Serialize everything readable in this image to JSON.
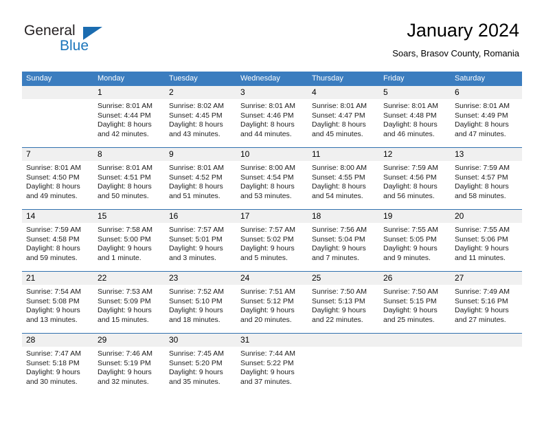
{
  "brand": {
    "name_part1": "General",
    "name_part2": "Blue",
    "accent_color": "#1b75bb"
  },
  "header": {
    "title": "January 2024",
    "subtitle": "Soars, Brasov County, Romania",
    "header_bg_color": "#3b7dbf",
    "daynum_bg_color": "#f0f0f0",
    "separator_color": "#2f6fae"
  },
  "weekdays": [
    "Sunday",
    "Monday",
    "Tuesday",
    "Wednesday",
    "Thursday",
    "Friday",
    "Saturday"
  ],
  "weeks": [
    {
      "days": [
        {
          "num": "",
          "lines": []
        },
        {
          "num": "1",
          "lines": [
            "Sunrise: 8:01 AM",
            "Sunset: 4:44 PM",
            "Daylight: 8 hours",
            "and 42 minutes."
          ]
        },
        {
          "num": "2",
          "lines": [
            "Sunrise: 8:02 AM",
            "Sunset: 4:45 PM",
            "Daylight: 8 hours",
            "and 43 minutes."
          ]
        },
        {
          "num": "3",
          "lines": [
            "Sunrise: 8:01 AM",
            "Sunset: 4:46 PM",
            "Daylight: 8 hours",
            "and 44 minutes."
          ]
        },
        {
          "num": "4",
          "lines": [
            "Sunrise: 8:01 AM",
            "Sunset: 4:47 PM",
            "Daylight: 8 hours",
            "and 45 minutes."
          ]
        },
        {
          "num": "5",
          "lines": [
            "Sunrise: 8:01 AM",
            "Sunset: 4:48 PM",
            "Daylight: 8 hours",
            "and 46 minutes."
          ]
        },
        {
          "num": "6",
          "lines": [
            "Sunrise: 8:01 AM",
            "Sunset: 4:49 PM",
            "Daylight: 8 hours",
            "and 47 minutes."
          ]
        }
      ]
    },
    {
      "days": [
        {
          "num": "7",
          "lines": [
            "Sunrise: 8:01 AM",
            "Sunset: 4:50 PM",
            "Daylight: 8 hours",
            "and 49 minutes."
          ]
        },
        {
          "num": "8",
          "lines": [
            "Sunrise: 8:01 AM",
            "Sunset: 4:51 PM",
            "Daylight: 8 hours",
            "and 50 minutes."
          ]
        },
        {
          "num": "9",
          "lines": [
            "Sunrise: 8:01 AM",
            "Sunset: 4:52 PM",
            "Daylight: 8 hours",
            "and 51 minutes."
          ]
        },
        {
          "num": "10",
          "lines": [
            "Sunrise: 8:00 AM",
            "Sunset: 4:54 PM",
            "Daylight: 8 hours",
            "and 53 minutes."
          ]
        },
        {
          "num": "11",
          "lines": [
            "Sunrise: 8:00 AM",
            "Sunset: 4:55 PM",
            "Daylight: 8 hours",
            "and 54 minutes."
          ]
        },
        {
          "num": "12",
          "lines": [
            "Sunrise: 7:59 AM",
            "Sunset: 4:56 PM",
            "Daylight: 8 hours",
            "and 56 minutes."
          ]
        },
        {
          "num": "13",
          "lines": [
            "Sunrise: 7:59 AM",
            "Sunset: 4:57 PM",
            "Daylight: 8 hours",
            "and 58 minutes."
          ]
        }
      ]
    },
    {
      "days": [
        {
          "num": "14",
          "lines": [
            "Sunrise: 7:59 AM",
            "Sunset: 4:58 PM",
            "Daylight: 8 hours",
            "and 59 minutes."
          ]
        },
        {
          "num": "15",
          "lines": [
            "Sunrise: 7:58 AM",
            "Sunset: 5:00 PM",
            "Daylight: 9 hours",
            "and 1 minute."
          ]
        },
        {
          "num": "16",
          "lines": [
            "Sunrise: 7:57 AM",
            "Sunset: 5:01 PM",
            "Daylight: 9 hours",
            "and 3 minutes."
          ]
        },
        {
          "num": "17",
          "lines": [
            "Sunrise: 7:57 AM",
            "Sunset: 5:02 PM",
            "Daylight: 9 hours",
            "and 5 minutes."
          ]
        },
        {
          "num": "18",
          "lines": [
            "Sunrise: 7:56 AM",
            "Sunset: 5:04 PM",
            "Daylight: 9 hours",
            "and 7 minutes."
          ]
        },
        {
          "num": "19",
          "lines": [
            "Sunrise: 7:55 AM",
            "Sunset: 5:05 PM",
            "Daylight: 9 hours",
            "and 9 minutes."
          ]
        },
        {
          "num": "20",
          "lines": [
            "Sunrise: 7:55 AM",
            "Sunset: 5:06 PM",
            "Daylight: 9 hours",
            "and 11 minutes."
          ]
        }
      ]
    },
    {
      "days": [
        {
          "num": "21",
          "lines": [
            "Sunrise: 7:54 AM",
            "Sunset: 5:08 PM",
            "Daylight: 9 hours",
            "and 13 minutes."
          ]
        },
        {
          "num": "22",
          "lines": [
            "Sunrise: 7:53 AM",
            "Sunset: 5:09 PM",
            "Daylight: 9 hours",
            "and 15 minutes."
          ]
        },
        {
          "num": "23",
          "lines": [
            "Sunrise: 7:52 AM",
            "Sunset: 5:10 PM",
            "Daylight: 9 hours",
            "and 18 minutes."
          ]
        },
        {
          "num": "24",
          "lines": [
            "Sunrise: 7:51 AM",
            "Sunset: 5:12 PM",
            "Daylight: 9 hours",
            "and 20 minutes."
          ]
        },
        {
          "num": "25",
          "lines": [
            "Sunrise: 7:50 AM",
            "Sunset: 5:13 PM",
            "Daylight: 9 hours",
            "and 22 minutes."
          ]
        },
        {
          "num": "26",
          "lines": [
            "Sunrise: 7:50 AM",
            "Sunset: 5:15 PM",
            "Daylight: 9 hours",
            "and 25 minutes."
          ]
        },
        {
          "num": "27",
          "lines": [
            "Sunrise: 7:49 AM",
            "Sunset: 5:16 PM",
            "Daylight: 9 hours",
            "and 27 minutes."
          ]
        }
      ]
    },
    {
      "days": [
        {
          "num": "28",
          "lines": [
            "Sunrise: 7:47 AM",
            "Sunset: 5:18 PM",
            "Daylight: 9 hours",
            "and 30 minutes."
          ]
        },
        {
          "num": "29",
          "lines": [
            "Sunrise: 7:46 AM",
            "Sunset: 5:19 PM",
            "Daylight: 9 hours",
            "and 32 minutes."
          ]
        },
        {
          "num": "30",
          "lines": [
            "Sunrise: 7:45 AM",
            "Sunset: 5:20 PM",
            "Daylight: 9 hours",
            "and 35 minutes."
          ]
        },
        {
          "num": "31",
          "lines": [
            "Sunrise: 7:44 AM",
            "Sunset: 5:22 PM",
            "Daylight: 9 hours",
            "and 37 minutes."
          ]
        },
        {
          "num": "",
          "lines": []
        },
        {
          "num": "",
          "lines": []
        },
        {
          "num": "",
          "lines": []
        }
      ]
    }
  ]
}
